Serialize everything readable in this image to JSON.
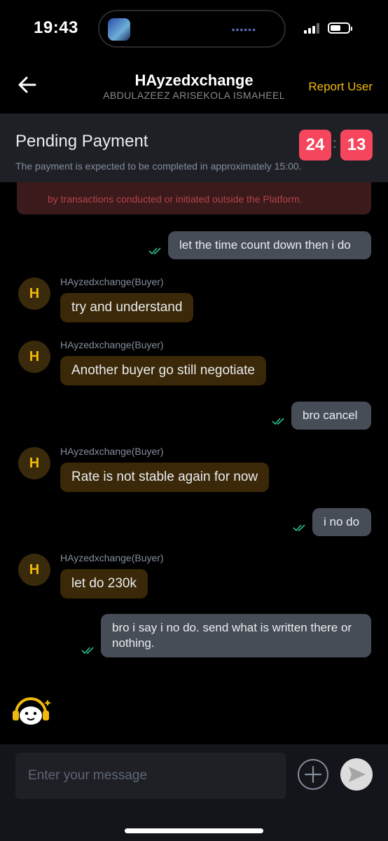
{
  "status_bar": {
    "time": "19:43"
  },
  "header": {
    "title": "HAyzedxchange",
    "subtitle": "ABDULAZEEZ ARISEKOLA ISMAHEEL",
    "report_label": "Report User"
  },
  "pending": {
    "title": "Pending Payment",
    "description": "The payment is expected to be completed in approximately 15:00.",
    "timer_minutes": "24",
    "timer_separator": ":",
    "timer_seconds": "13"
  },
  "warning_text": "by transactions conducted or initiated outside the Platform.",
  "messages": [
    {
      "direction": "out",
      "text": "let the time count down then i do"
    },
    {
      "direction": "in",
      "avatar": "H",
      "sender": "HAyzedxchange(Buyer)",
      "text": "try and understand"
    },
    {
      "direction": "in",
      "avatar": "H",
      "sender": "HAyzedxchange(Buyer)",
      "text": "Another buyer go still negotiate"
    },
    {
      "direction": "out",
      "text": "bro cancel"
    },
    {
      "direction": "in",
      "avatar": "H",
      "sender": "HAyzedxchange(Buyer)",
      "text": "Rate is not stable again for now"
    },
    {
      "direction": "out",
      "text": "i no do"
    },
    {
      "direction": "in",
      "avatar": "H",
      "sender": "HAyzedxchange(Buyer)",
      "text": "let do 230k"
    },
    {
      "direction": "out",
      "text": "bro i say i no do. send what is written there or nothing."
    }
  ],
  "composer": {
    "placeholder": "Enter your message"
  },
  "icons": {
    "back": "arrow-left-icon",
    "add": "plus-circle-icon",
    "send": "send-icon",
    "bot": "support-bot-icon",
    "read": "double-check-icon"
  },
  "colors": {
    "accent": "#f0b90b",
    "timer": "#f6465d",
    "read_check": "#2ebd85",
    "incoming_bubble": "#3a2808",
    "outgoing_bubble": "#474d57"
  }
}
